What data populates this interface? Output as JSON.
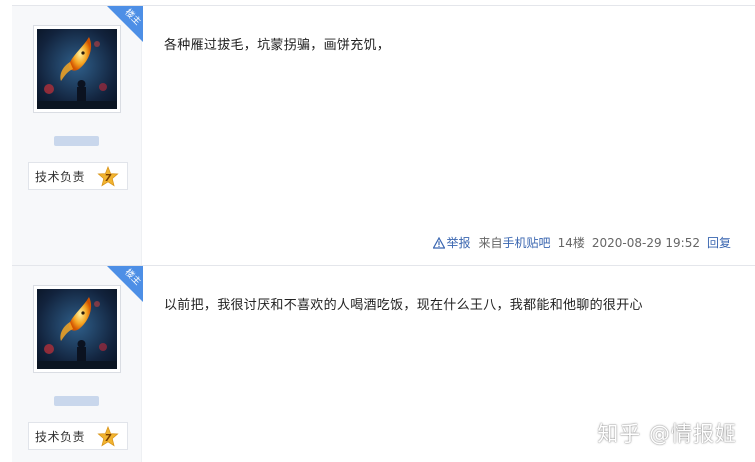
{
  "posts": [
    {
      "louzhu_label": "楼主",
      "badge_label": "技术负责",
      "badge_level": "7",
      "content": "各种雁过拔毛，坑蒙拐骗，画饼充饥，",
      "report_label": "举报",
      "source_prefix": "来自",
      "source_link": "手机贴吧",
      "floor": "14楼",
      "timestamp": "2020-08-29 19:52",
      "reply_label": "回复"
    },
    {
      "louzhu_label": "楼主",
      "badge_label": "技术负责",
      "badge_level": "7",
      "content": "以前把，我很讨厌和不喜欢的人喝酒吃饭，现在什么王八，我都能和他聊的很开心"
    }
  ],
  "watermark": "知乎 @情报姬",
  "colors": {
    "accent_blue": "#3a66b0",
    "louzhu_blue": "#4d8fe6",
    "star_gold": "#f2b430"
  }
}
